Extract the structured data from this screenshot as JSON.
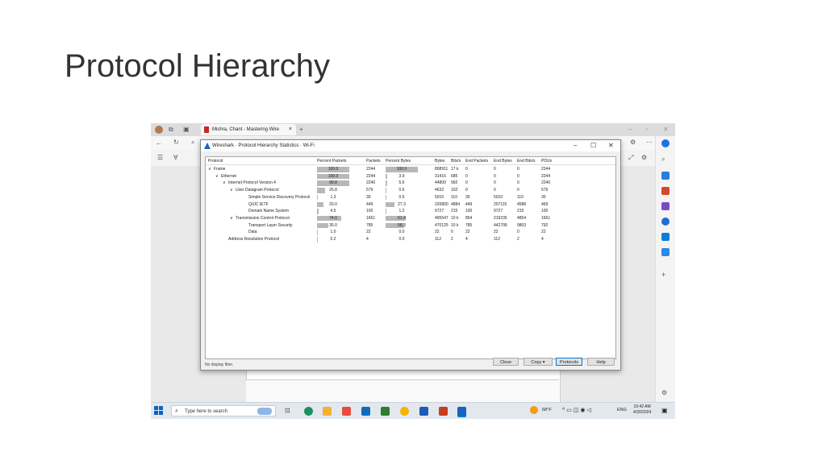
{
  "slide": {
    "title": "Protocol Hierarchy"
  },
  "browser": {
    "tab_title": "Mishra, Chant - Mastering Wire",
    "tab_close": "×",
    "new_tab": "+"
  },
  "window": {
    "title": "Wireshark · Protocol Hierarchy Statistics · Wi-Fi",
    "minimize": "–",
    "maximize": "☐",
    "close": "✕"
  },
  "columns": [
    "Protocol",
    "Percent Packets",
    "Packets",
    "Percent Bytes",
    "Bytes",
    "Bits/s",
    "End Packets",
    "End Bytes",
    "End Bits/s",
    "PDUs"
  ],
  "rows": [
    {
      "protocol": "Frame",
      "toggle": "∨",
      "level": 0,
      "pct_packets": "100.0",
      "packets": "2244",
      "pct_bytes": "100.0",
      "bytes": "808911",
      "bits": "17 k",
      "end_packets": "0",
      "end_bytes": "0",
      "end_bits": "0",
      "pdus": "2244"
    },
    {
      "protocol": "Ethernet",
      "toggle": "∨",
      "level": 1,
      "pct_packets": "100.0",
      "packets": "2244",
      "pct_bytes": "3.9",
      "bytes": "31416",
      "bits": "685",
      "end_packets": "0",
      "end_bytes": "0",
      "end_bits": "0",
      "pdus": "2244"
    },
    {
      "protocol": "Internet Protocol Version 4",
      "toggle": "∨",
      "level": 2,
      "pct_packets": "99.8",
      "packets": "2240",
      "pct_bytes": "5.6",
      "bytes": "44800",
      "bits": "992",
      "end_packets": "0",
      "end_bytes": "0",
      "end_bits": "0",
      "pdus": "2240"
    },
    {
      "protocol": "User Datagram Protocol",
      "toggle": "∨",
      "level": 3,
      "pct_packets": "25.8",
      "packets": "579",
      "pct_bytes": "0.6",
      "bytes": "4632",
      "bits": "102",
      "end_packets": "0",
      "end_bytes": "0",
      "end_bits": "0",
      "pdus": "579"
    },
    {
      "protocol": "Simple Service Discovery Protocol",
      "toggle": "",
      "level": 4,
      "pct_packets": "1.3",
      "packets": "30",
      "pct_bytes": "0.6",
      "bytes": "5010",
      "bits": "110",
      "end_packets": "30",
      "end_bytes": "5010",
      "end_bits": "110",
      "pdus": "30"
    },
    {
      "protocol": "QUIC IETF",
      "toggle": "",
      "level": 4,
      "pct_packets": "20.0",
      "packets": "449",
      "pct_bytes": "27.3",
      "bytes": "220800",
      "bits": "4884",
      "end_packets": "449",
      "end_bytes": "207115",
      "end_bits": "4588",
      "pdus": "469"
    },
    {
      "protocol": "Domain Name System",
      "toggle": "",
      "level": 4,
      "pct_packets": "4.5",
      "packets": "100",
      "pct_bytes": "1.2",
      "bytes": "9727",
      "bits": "215",
      "end_packets": "100",
      "end_bytes": "9727",
      "end_bits": "215",
      "pdus": "100"
    },
    {
      "protocol": "Transmission Control Protocol",
      "toggle": "∨",
      "level": 3,
      "pct_packets": "74.0",
      "packets": "1661",
      "pct_bytes": "61.4",
      "bytes": "495547",
      "bits": "10 k",
      "end_packets": "854",
      "end_bytes": "219235",
      "end_bits": "4854",
      "pdus": "1661"
    },
    {
      "protocol": "Transport Layer Security",
      "toggle": "",
      "level": 4,
      "pct_packets": "35.0",
      "packets": "785",
      "pct_bytes": "58.3",
      "bytes": "470125",
      "bits": "10 k",
      "end_packets": "785",
      "end_bytes": "442708",
      "end_bits": "9803",
      "pdus": "792"
    },
    {
      "protocol": "Data",
      "toggle": "",
      "level": 4,
      "pct_packets": "1.0",
      "packets": "22",
      "pct_bytes": "0.0",
      "bytes": "22",
      "bits": "0",
      "end_packets": "22",
      "end_bytes": "22",
      "end_bits": "0",
      "pdus": "22"
    },
    {
      "protocol": "Address Resolution Protocol",
      "toggle": "",
      "level": 2,
      "pct_packets": "0.2",
      "packets": "4",
      "pct_bytes": "0.0",
      "bytes": "112",
      "bits": "2",
      "end_packets": "4",
      "end_bytes": "112",
      "end_bits": "2",
      "pdus": "4"
    }
  ],
  "footer": {
    "filter_label": "No display filter.",
    "close": "Close",
    "copy": "Copy",
    "copy_arrow": "▾",
    "protocols": "Protocols",
    "help": "Help"
  },
  "taskbar": {
    "search_placeholder": "Type here to search",
    "weather": "68°F",
    "lang": "ENG",
    "time": "10:42 AM",
    "date": "4/30/2024"
  },
  "colors": {
    "bar": "#b8b8b8",
    "accent": "#1565c0",
    "taskbar": "#e3e8ef"
  }
}
